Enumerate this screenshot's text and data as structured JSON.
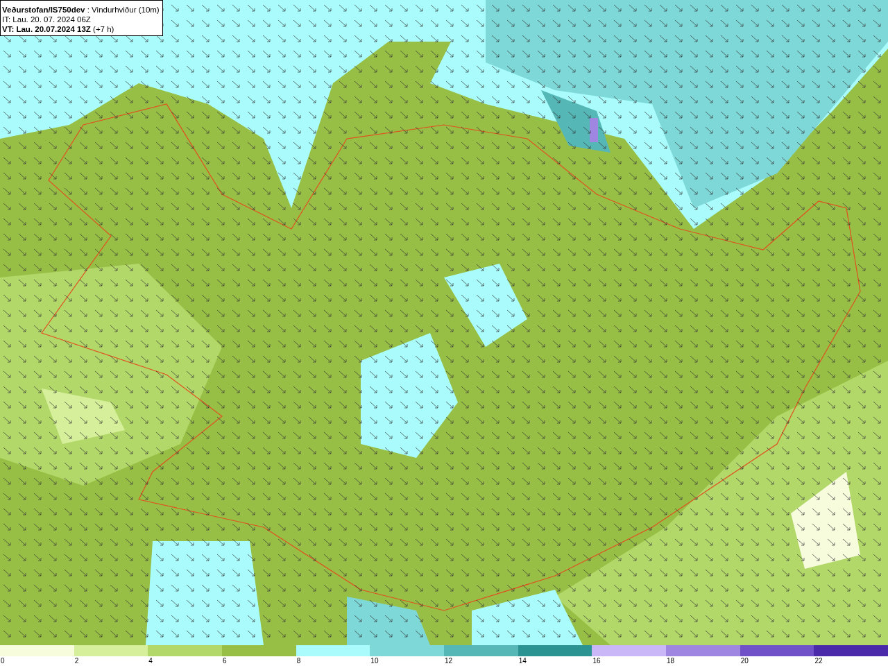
{
  "title_box": {
    "heading": "**Veðurstofan/IS750dev** : Vindurhviður (10m)",
    "issue_time": "IT: Lau. 20. 07. 2024 06Z",
    "valid_time": "**VT: Lau. 20.07.2024 13Z** (+7 h)"
  },
  "legend": {
    "bins": [
      {
        "label": "0",
        "color": "#f7fcdc"
      },
      {
        "label": "2",
        "color": "#d6ef9a"
      },
      {
        "label": "4",
        "color": "#b3d86a"
      },
      {
        "label": "6",
        "color": "#98bf45"
      },
      {
        "label": "8",
        "color": "#aafcfc"
      },
      {
        "label": "10",
        "color": "#7fd8d8"
      },
      {
        "label": "12",
        "color": "#56b7b7"
      },
      {
        "label": "14",
        "color": "#2b9492"
      },
      {
        "label": "16",
        "color": "#c9b7f8"
      },
      {
        "label": "18",
        "color": "#9f86e0"
      },
      {
        "label": "20",
        "color": "#7151c8"
      },
      {
        "label": "22",
        "color": "#4a2aa8"
      }
    ]
  }
}
